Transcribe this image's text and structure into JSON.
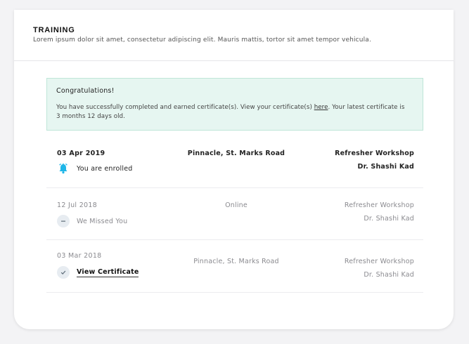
{
  "header": {
    "title": "TRAINING",
    "subtitle": "Lorem ipsum dolor sit amet, consectetur adipiscing elit. Mauris mattis, tortor sit amet tempor vehicula."
  },
  "alert": {
    "title": "Congratulations!",
    "body_before": "You have successfully completed and earned certificate(s). View your certificate(s) ",
    "link": "here",
    "body_after": ". Your latest certificate is 3 months 12 days old."
  },
  "sessions": [
    {
      "date": "03 Apr 2019",
      "status": "You are enrolled",
      "status_icon": "bell-icon",
      "location": "Pinnacle, St. Marks Road",
      "workshop": "Refresher Workshop",
      "trainer": "Dr. Shashi Kad"
    },
    {
      "date": "12 Jul 2018",
      "status": "We Missed You",
      "status_icon": "minus-icon",
      "location": "Online",
      "workshop": "Refresher Workshop",
      "trainer": "Dr. Shashi Kad"
    },
    {
      "date": "03 Mar 2018",
      "status": "View Certificate",
      "status_icon": "check-icon",
      "location": "Pinnacle, St. Marks Road",
      "workshop": "Refresher Workshop",
      "trainer": "Dr. Shashi Kad"
    }
  ],
  "colors": {
    "accent": "#1fb6e8",
    "alert_bg": "#e6f6f1",
    "alert_border": "#bfe6d8",
    "muted_text": "#8a8a8f"
  }
}
